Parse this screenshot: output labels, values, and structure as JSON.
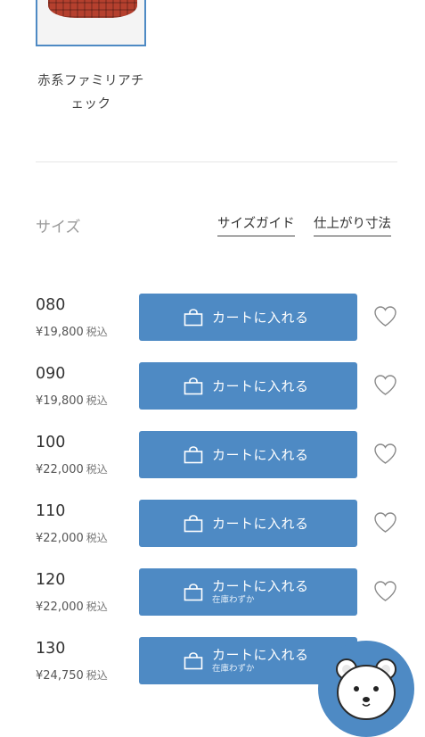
{
  "product": {
    "color_name": "赤系ファミリアチェック"
  },
  "size_section": {
    "label": "サイズ",
    "size_guide_link": "サイズガイド",
    "measurements_link": "仕上がり寸法"
  },
  "sizes": [
    {
      "size": "080",
      "price": "¥19,800",
      "tax": "税込",
      "button_label": "カートに入れる",
      "stock_note": ""
    },
    {
      "size": "090",
      "price": "¥19,800",
      "tax": "税込",
      "button_label": "カートに入れる",
      "stock_note": ""
    },
    {
      "size": "100",
      "price": "¥22,000",
      "tax": "税込",
      "button_label": "カートに入れる",
      "stock_note": ""
    },
    {
      "size": "110",
      "price": "¥22,000",
      "tax": "税込",
      "button_label": "カートに入れる",
      "stock_note": ""
    },
    {
      "size": "120",
      "price": "¥22,000",
      "tax": "税込",
      "button_label": "カートに入れる",
      "stock_note": "在庫わずか"
    },
    {
      "size": "130",
      "price": "¥24,750",
      "tax": "税込",
      "button_label": "カートに入れる",
      "stock_note": "在庫わずか"
    }
  ],
  "icons": {
    "cart": "shopping-bag-icon",
    "favorite": "heart-outline-icon",
    "mascot": "bear-icon"
  },
  "colors": {
    "accent": "#4e8ac4",
    "text": "#333333",
    "muted": "#9a9a9a"
  }
}
